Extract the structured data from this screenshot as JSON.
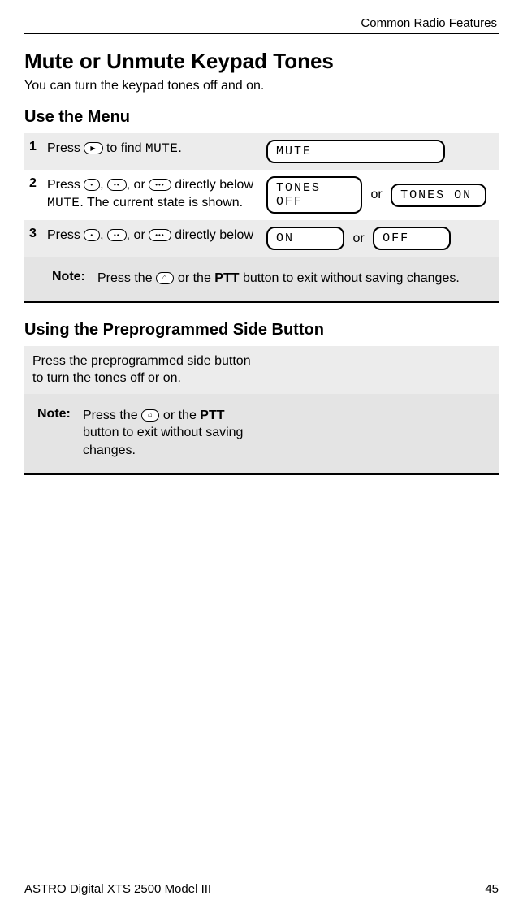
{
  "header": {
    "section": "Common Radio Features"
  },
  "title": "Mute or Unmute Keypad Tones",
  "intro": "You can turn the keypad tones off and on.",
  "use_menu": {
    "heading": "Use the Menu",
    "step1": {
      "num": "1",
      "text_a": "Press ",
      "text_b": " to find ",
      "mute": "MUTE",
      "period": ".",
      "display": "MUTE"
    },
    "step2": {
      "num": "2",
      "text_a": "Press ",
      "comma1": ", ",
      "comma2": ", or ",
      "text_b": " directly below ",
      "mute": "MUTE",
      "text_c": ". The current state is shown.",
      "disp_a": "TONES OFF",
      "or": "or",
      "disp_b": "TONES ON"
    },
    "step3": {
      "num": "3",
      "text_a": "Press ",
      "comma1": ", ",
      "comma2": ", or ",
      "text_b": " directly below",
      "disp_a": "ON",
      "or": "or",
      "disp_b": "OFF"
    },
    "note": {
      "label": "Note:",
      "text_a": "Press the ",
      "text_b": " or the ",
      "ptt": "PTT",
      "text_c": " button to exit without saving changes."
    }
  },
  "side_button": {
    "heading": "Using the Preprogrammed Side Button",
    "instr": "Press the preprogrammed side button to turn the tones off or on.",
    "note": {
      "label": "Note:",
      "text_a": "Press the ",
      "text_b": " or the ",
      "ptt": "PTT",
      "text_c": " button to exit without saving changes."
    }
  },
  "footer": {
    "product": "ASTRO Digital XTS 2500 Model III",
    "page": "45"
  },
  "icons": {
    "nav": "▶",
    "dot1": "•",
    "dot2": "••",
    "dot3": "•••",
    "home": "⌂"
  }
}
